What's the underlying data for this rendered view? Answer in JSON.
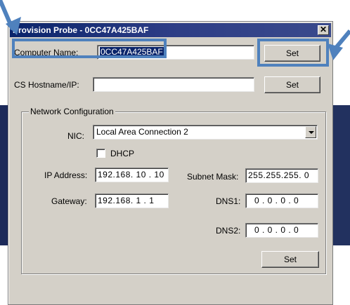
{
  "window": {
    "title": "Provision Probe - 0CC47A425BAF",
    "close_glyph": "✕"
  },
  "computer": {
    "label": "Computer Name:",
    "value": "0CC47A425BAF",
    "set_label": "Set"
  },
  "cs": {
    "label": "CS Hostname/IP:",
    "value": "",
    "set_label": "Set"
  },
  "network": {
    "group_label": "Network Configuration",
    "nic_label": "NIC:",
    "nic_value": "Local Area Connection 2",
    "dhcp_label": "DHCP",
    "dhcp_checked": false,
    "ip_label": "IP Address:",
    "ip_value": "192.168. 10 . 10",
    "subnet_label": "Subnet Mask:",
    "subnet_value": "255.255.255.  0",
    "gateway_label": "Gateway:",
    "gateway_value": "192.168.  1  .  1",
    "dns1_label": "DNS1:",
    "dns1_value": "0  .  0  .  0  .  0",
    "dns2_label": "DNS2:",
    "dns2_value": "0  .  0  .  0  .  0",
    "set_label": "Set"
  },
  "colors": {
    "highlight": "#4f81bd",
    "titlebar": "#0a246a",
    "dialog": "#d4d0c8"
  },
  "icons": [
    "close-icon",
    "dropdown-arrow-icon",
    "annotation-arrow-icon"
  ]
}
